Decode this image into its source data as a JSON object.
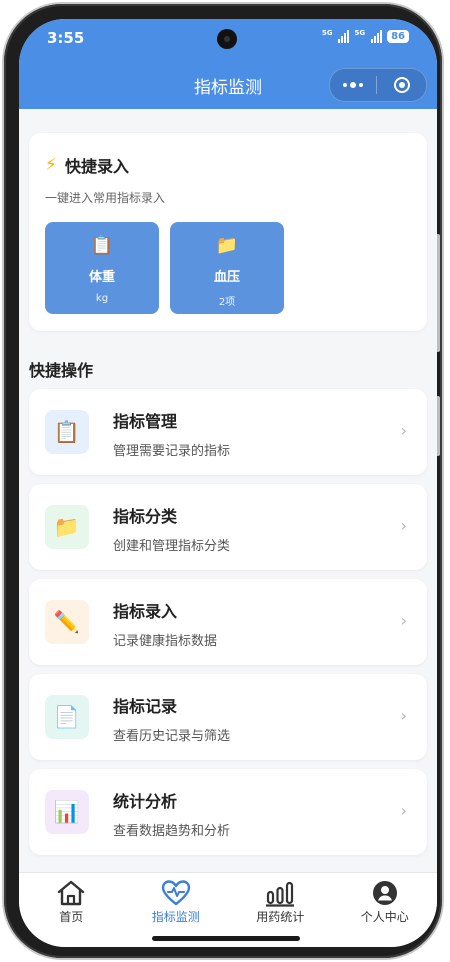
{
  "status": {
    "time": "3:55",
    "net1": "5G",
    "net2": "5G",
    "battery": "86"
  },
  "header": {
    "title": "指标监测"
  },
  "quick_entry": {
    "icon": "⚡",
    "title": "快捷录入",
    "subtitle": "一键进入常用指标录入",
    "tiles": [
      {
        "icon": "📋",
        "name": "体重",
        "unit": "kg"
      },
      {
        "icon": "📁",
        "name": "血压",
        "unit": "2项"
      }
    ]
  },
  "quick_ops": {
    "title": "快捷操作",
    "items": [
      {
        "icon": "📋",
        "title": "指标管理",
        "desc": "管理需要记录的指标",
        "bg": "#e6f0fd"
      },
      {
        "icon": "📁",
        "title": "指标分类",
        "desc": "创建和管理指标分类",
        "bg": "#e7f7ec"
      },
      {
        "icon": "✏️",
        "title": "指标录入",
        "desc": "记录健康指标数据",
        "bg": "#fdf2e3"
      },
      {
        "icon": "📄",
        "title": "指标记录",
        "desc": "查看历史记录与筛选",
        "bg": "#e4f6f2"
      },
      {
        "icon": "📊",
        "title": "统计分析",
        "desc": "查看数据趋势和分析",
        "bg": "#f3e9fa"
      }
    ],
    "chevron": "›"
  },
  "tabbar": {
    "items": [
      {
        "label": "首页",
        "icon": "home-icon"
      },
      {
        "label": "指标监测",
        "icon": "heart-pulse-icon"
      },
      {
        "label": "用药统计",
        "icon": "bar-stats-icon"
      },
      {
        "label": "个人中心",
        "icon": "user-icon"
      }
    ],
    "active": "指标监测",
    "active_color": "#3c7fd8"
  },
  "colors": {
    "header": "#4a8ee6",
    "tile": "#5c93df",
    "accent": "#f6b400"
  }
}
